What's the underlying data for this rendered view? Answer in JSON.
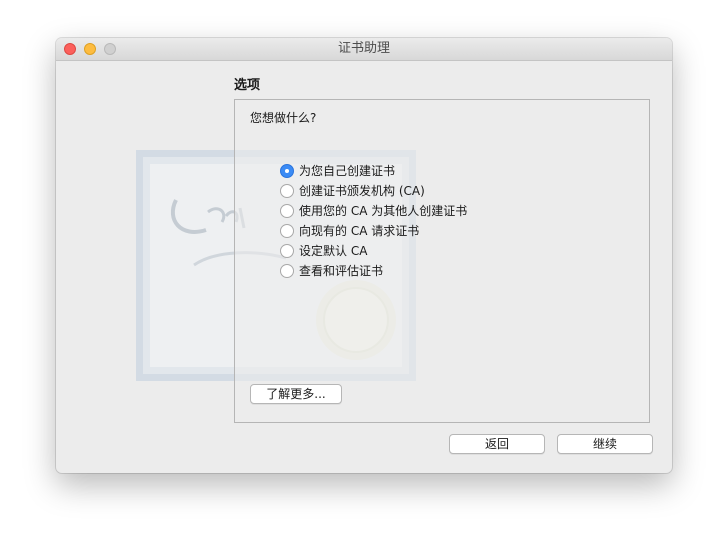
{
  "window": {
    "title": "证书助理"
  },
  "section": {
    "title": "选项"
  },
  "panel": {
    "question": "您想做什么?",
    "options": [
      {
        "label": "为您自己创建证书",
        "selected": true
      },
      {
        "label": "创建证书颁发机构 (CA)",
        "selected": false
      },
      {
        "label": "使用您的 CA 为其他人创建证书",
        "selected": false
      },
      {
        "label": "向现有的 CA 请求证书",
        "selected": false
      },
      {
        "label": "设定默认 CA",
        "selected": false
      },
      {
        "label": "查看和评估证书",
        "selected": false
      }
    ],
    "learn_more_label": "了解更多..."
  },
  "footer": {
    "back_label": "返回",
    "continue_label": "继续"
  },
  "colors": {
    "accent": "#3b8bf5",
    "close": "#fc605c",
    "minimize": "#fdbc40",
    "zoom_disabled": "#d0d0d0"
  },
  "icons": {
    "illustration": "certificate-illustration",
    "seal": "certificate-seal-icon"
  }
}
